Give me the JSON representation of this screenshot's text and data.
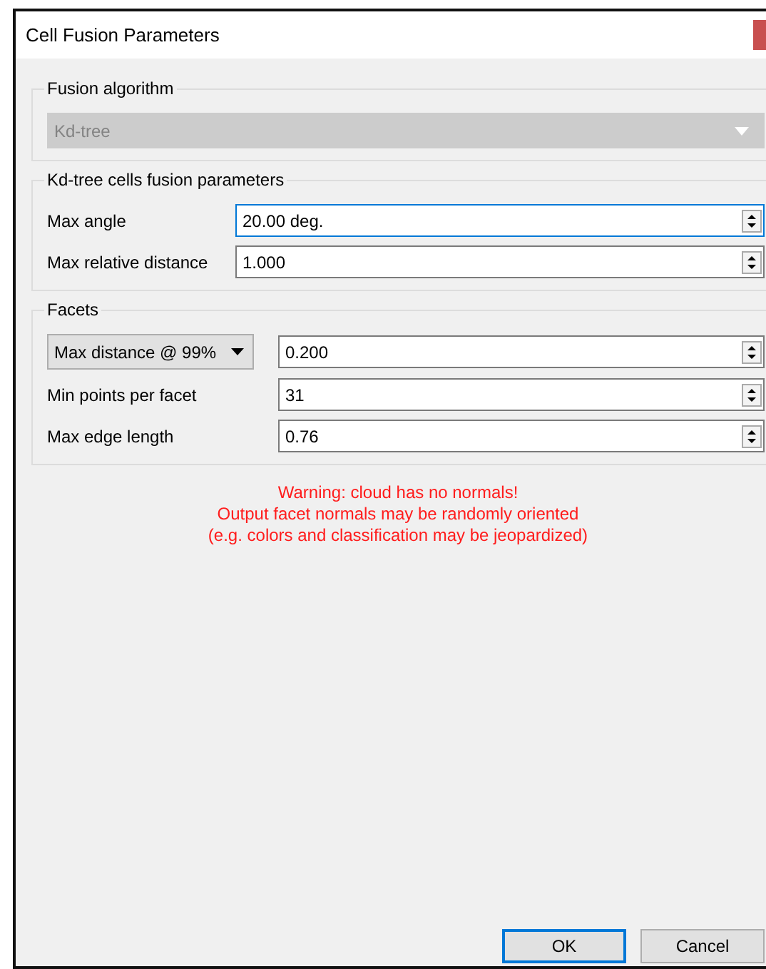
{
  "window": {
    "title": "Cell Fusion Parameters"
  },
  "algorithm_group": {
    "title": "Fusion algorithm",
    "combo": {
      "value": "Kd-tree",
      "disabled": true
    }
  },
  "kdtree_group": {
    "title": "Kd-tree cells fusion parameters",
    "rows": [
      {
        "kind": "label",
        "label": "Max angle",
        "value": "20.00 deg.",
        "focused": true
      },
      {
        "kind": "label",
        "label": "Max relative distance",
        "value": "1.000",
        "focused": false
      }
    ]
  },
  "facets_group": {
    "title": "Facets",
    "rows": [
      {
        "kind": "combo",
        "label": "Max distance @ 99%",
        "value": "0.200",
        "focused": false
      },
      {
        "kind": "label",
        "label": "Min points per facet",
        "value": "31",
        "focused": false
      },
      {
        "kind": "label",
        "label": "Max edge length",
        "value": "0.76",
        "focused": false
      }
    ]
  },
  "warning": [
    "Warning: cloud has no normals!",
    "Output facet normals may be randomly oriented",
    "(e.g. colors and classification may be jeopardized)"
  ],
  "buttons": [
    {
      "label": "OK",
      "default": true
    },
    {
      "label": "Cancel",
      "default": false
    }
  ]
}
